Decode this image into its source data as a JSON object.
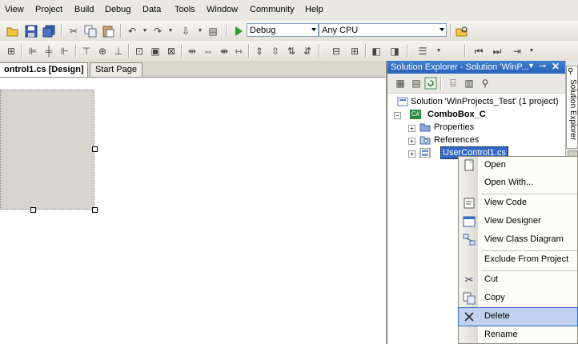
{
  "menu": [
    "View",
    "Project",
    "Build",
    "Debug",
    "Data",
    "Tools",
    "Window",
    "Community",
    "Help"
  ],
  "toolbar": {
    "config_combo": "Debug",
    "platform_combo": "Any CPU"
  },
  "document_tabs": [
    {
      "label": "ontrol1.cs [Design]",
      "active": true
    },
    {
      "label": "Start Page",
      "active": false
    }
  ],
  "solution_explorer": {
    "title": "Solution Explorer - Solution 'WinP...",
    "side_tab": "Solution Explorer",
    "tree": {
      "solution": "Solution 'WinProjects_Test' (1 project)",
      "project": "ComboBox_C",
      "project_badge": "C#",
      "children": [
        "Properties",
        "References",
        "UserControl1.cs"
      ]
    }
  },
  "context_menu": {
    "items": [
      {
        "label": "Open",
        "icon": "open-icon"
      },
      {
        "label": "Open With...",
        "icon": ""
      },
      {
        "label": "View Code",
        "icon": "view-code-icon"
      },
      {
        "label": "View Designer",
        "icon": "view-designer-icon"
      },
      {
        "label": "View Class Diagram",
        "icon": "class-diagram-icon"
      },
      {
        "label": "Exclude From Project",
        "icon": ""
      },
      {
        "label": "Cut",
        "icon": "cut-icon"
      },
      {
        "label": "Copy",
        "icon": "copy-icon"
      },
      {
        "label": "Delete",
        "icon": "delete-icon",
        "selected": true
      },
      {
        "label": "Rename",
        "icon": ""
      }
    ]
  },
  "colors": {
    "title_bar": "#2a63b9",
    "selection": "#316ac5",
    "menu_highlight": "#c1d2ee"
  }
}
